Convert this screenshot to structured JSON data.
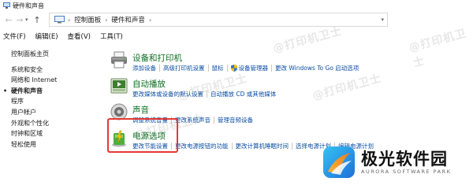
{
  "window": {
    "title": "硬件和声音"
  },
  "address": {
    "crumbs": [
      "控制面板",
      "硬件和声音"
    ]
  },
  "menu": [
    "文件(F)",
    "编辑(E)",
    "查看(V)",
    "工具(T)"
  ],
  "sidebar": {
    "items": [
      {
        "label": "控制面板主页"
      },
      {
        "label": "系统和安全"
      },
      {
        "label": "网络和 Internet"
      },
      {
        "label": "硬件和声音",
        "current": true
      },
      {
        "label": "程序"
      },
      {
        "label": "用户帐户"
      },
      {
        "label": "外观和个性化"
      },
      {
        "label": "时钟和区域"
      },
      {
        "label": "轻松使用"
      }
    ]
  },
  "categories": [
    {
      "title": "设备和打印机",
      "icon": "printer-icon",
      "links": [
        "添加设备",
        "高级打印机设置",
        "鼠标",
        "设备管理器",
        "更改 Windows To Go 启动选项"
      ]
    },
    {
      "title": "自动播放",
      "icon": "autoplay-icon",
      "links": [
        "更改媒体或设备的默认设置",
        "自动播放 CD 或其他媒体"
      ]
    },
    {
      "title": "声音",
      "icon": "speaker-icon",
      "links": [
        "调整系统音量",
        "更改系统声音",
        "管理音频设备"
      ]
    },
    {
      "title": "电源选项",
      "icon": "power-icon",
      "links": [
        "更改节能设置",
        "更改电源按钮的功能",
        "更改计算机睡眠时间",
        "选择电源计划",
        "编辑电源计划"
      ]
    }
  ],
  "watermark": "@打印机卫士",
  "brand": {
    "name": "极光软件园",
    "subtitle": "AURORA SOFTWARE PARK"
  },
  "colors": {
    "category_title": "#0a6e1f",
    "link": "#0b4ea2",
    "highlight": "#e53935"
  }
}
